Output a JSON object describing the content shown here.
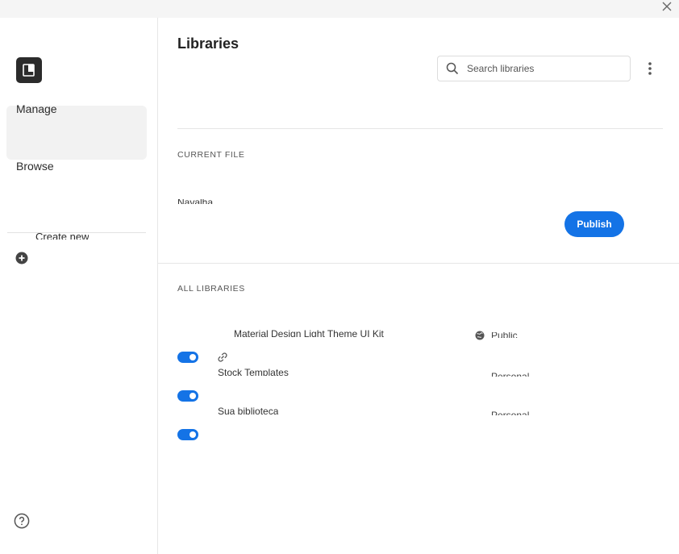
{
  "sidebar": {
    "nav": [
      {
        "label": "Manage",
        "active": true
      },
      {
        "label": "Browse",
        "active": false
      }
    ],
    "create_label": "Create new"
  },
  "main": {
    "title": "Libraries",
    "search": {
      "placeholder": "Search libraries"
    },
    "current_file": {
      "section_label": "CURRENT FILE",
      "file_name": "Navalha",
      "publish_label": "Publish"
    },
    "all_libraries": {
      "section_label": "ALL LIBRARIES",
      "items": [
        {
          "name": "Material Design Light Theme UI Kit",
          "status": "Public",
          "enabled": true
        },
        {
          "name": "Stock Templates",
          "status": "Personal",
          "enabled": true
        },
        {
          "name": "Sua biblioteca",
          "status": "Personal",
          "enabled": true
        }
      ]
    }
  },
  "colors": {
    "accent": "#1473e6",
    "logo_bg": "#2b2b2b",
    "active_nav_bg": "#f2f2f2"
  },
  "icons": [
    "close-icon",
    "library-logo-icon",
    "plus-circle-icon",
    "help-icon",
    "search-icon",
    "more-vertical-icon",
    "link-icon",
    "globe-icon"
  ]
}
